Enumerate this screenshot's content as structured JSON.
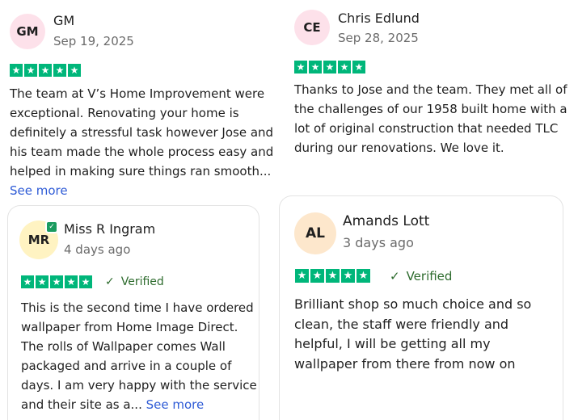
{
  "reviews": [
    {
      "initials": "GM",
      "name": "GM",
      "date": "Sep 19, 2025",
      "rating": 5,
      "verified_label": "",
      "text": "The team at V’s Home Improvement were exceptional. Renovating your home is definitely a stressful task however Jose and his team made the whole process easy and helped in making sure things ran smooth...",
      "see_more": "See more"
    },
    {
      "initials": "CE",
      "name": "Chris Edlund",
      "date": "Sep 28, 2025",
      "rating": 5,
      "verified_label": "",
      "text": "Thanks to Jose and the team. They met all of the challenges of our 1958 built home with a lot of original construction that needed TLC during our renovations. We love it.",
      "see_more": ""
    },
    {
      "initials": "MR",
      "name": "Miss R Ingram",
      "date": "4 days ago",
      "rating": 5,
      "verified_label": "Verified",
      "text": "This is the second time I have ordered wallpaper from Home Image Direct. The rolls of Wallpaper comes Wall packaged and arrive in a couple of days. I am very happy with the service and their site as a...",
      "see_more": "See more"
    },
    {
      "initials": "AL",
      "name": "Amands Lott",
      "date": "3 days ago",
      "rating": 5,
      "verified_label": "Verified",
      "text": "Brilliant shop so much choice and so clean, the staff were friendly and helpful, I will be getting all my wallpaper from there from now on",
      "see_more": ""
    }
  ],
  "icons": {
    "star": "★",
    "check": "✓",
    "badge_check": "✓"
  },
  "colors": {
    "star_green": "#00b67a",
    "verified_green": "#2d6b2d",
    "link_blue": "#2e5bd6",
    "avatar_pink": "#fde1ea",
    "avatar_yellow": "#fff3c2",
    "avatar_peach": "#fde7cc"
  }
}
